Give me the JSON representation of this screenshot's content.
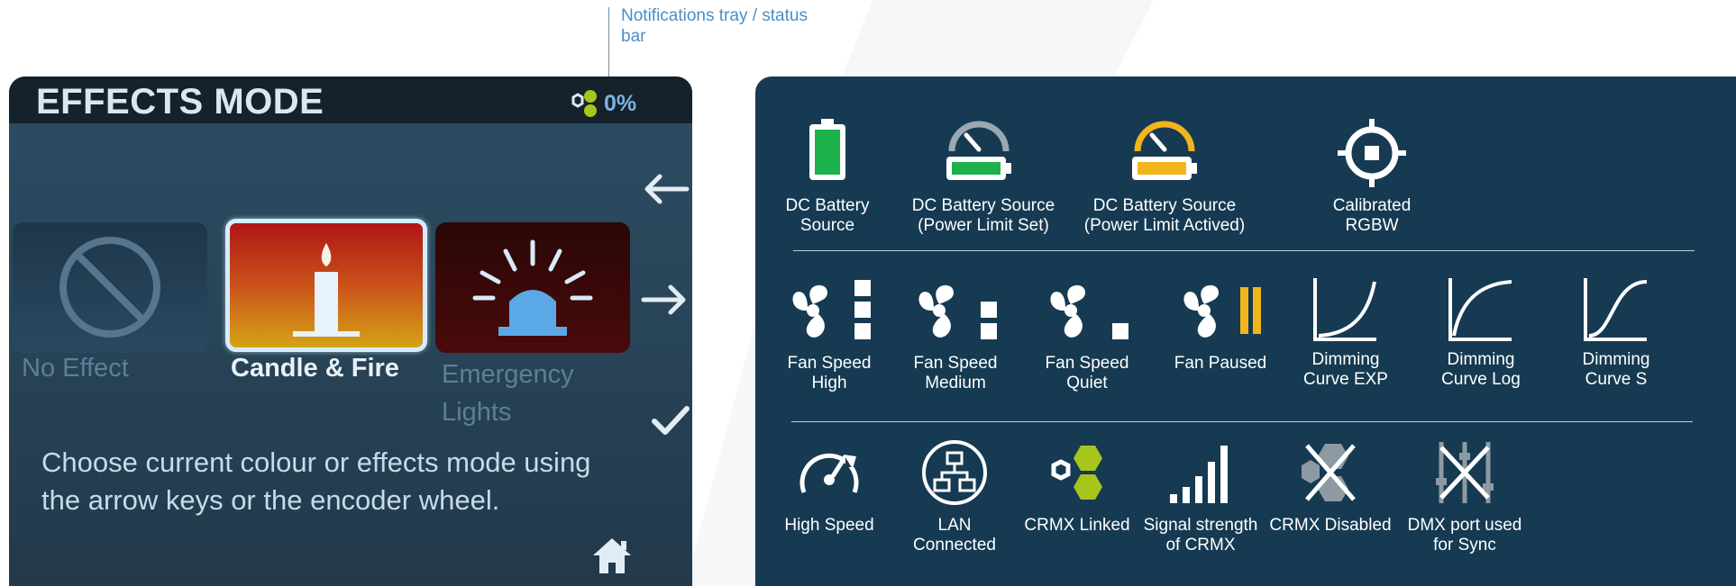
{
  "callout": {
    "text": "Notifications tray / status bar"
  },
  "device": {
    "title": "EFFECTS MODE",
    "status_percent": "0%",
    "effects": [
      {
        "label": "No Effect",
        "state": "inactive"
      },
      {
        "label": "Candle & Fire",
        "state": "selected"
      },
      {
        "label": "Emergency Lights",
        "state": "inactive"
      }
    ],
    "hint": "Choose current colour or effects mode using the arrow keys or the encoder wheel."
  },
  "legend": {
    "row1": [
      {
        "icon": "battery-icon",
        "caption": "DC Battery Source"
      },
      {
        "icon": "battery-gauge-icon",
        "caption": "DC Battery Source (Power Limit Set)"
      },
      {
        "icon": "battery-gauge-amber-icon",
        "caption": "DC Battery Source (Power Limit Actived)"
      },
      {
        "icon": "crosshair-icon",
        "caption": "Calibrated RGBW"
      }
    ],
    "row2": [
      {
        "icon": "fan-high-icon",
        "caption": "Fan Speed High"
      },
      {
        "icon": "fan-medium-icon",
        "caption": "Fan Speed Medium"
      },
      {
        "icon": "fan-quiet-icon",
        "caption": "Fan Speed Quiet"
      },
      {
        "icon": "fan-paused-icon",
        "caption": "Fan Paused"
      },
      {
        "icon": "curve-exp-icon",
        "caption": "Dimming Curve EXP"
      },
      {
        "icon": "curve-log-icon",
        "caption": "Dimming Curve Log"
      },
      {
        "icon": "curve-s-icon",
        "caption": "Dimming Curve S"
      }
    ],
    "row3": [
      {
        "icon": "speedometer-icon",
        "caption": "High Speed"
      },
      {
        "icon": "lan-icon",
        "caption": "LAN Connected"
      },
      {
        "icon": "crmx-linked-icon",
        "caption": "CRMX Linked"
      },
      {
        "icon": "signal-bars-icon",
        "caption": "Signal strength of CRMX"
      },
      {
        "icon": "crmx-disabled-icon",
        "caption": "CRMX Disabled"
      },
      {
        "icon": "dmx-sync-icon",
        "caption": "DMX port used for Sync"
      }
    ]
  },
  "colors": {
    "panel_bg": "#163a52",
    "battery_green": "#1db14b",
    "amber": "#f2b51c",
    "crmx_green": "#a8c51d"
  }
}
